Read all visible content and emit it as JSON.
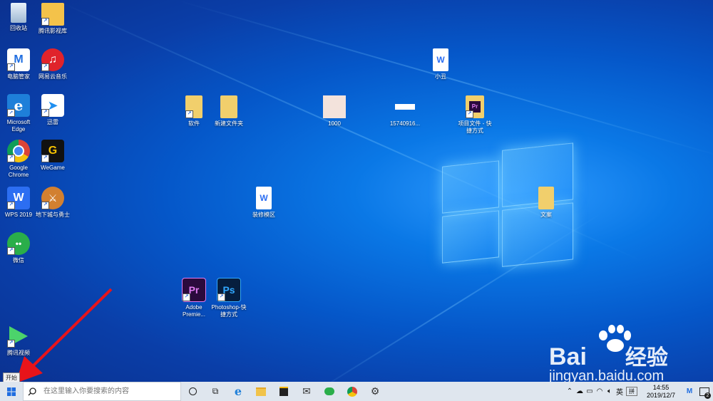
{
  "desktop_icons": {
    "recycle_bin": "回收站",
    "tencent_video_library": "腾讯影视库",
    "pc_manager": "电脑管家",
    "netease_music": "网易云音乐",
    "edge": "Microsoft Edge",
    "xunlei": "迅雷",
    "chrome": "Google Chrome",
    "wegame": "WeGame",
    "wps": "WPS 2019",
    "dnf": "地下城与勇士",
    "wechat": "微信",
    "tencent_video": "腾讯视频",
    "software": "软件",
    "new_folder": "新建文件夹",
    "photo_1000": "1000",
    "file_1574": "15740916...",
    "xiaochou": "小丑",
    "project_shortcut": "项目文件 - 快捷方式",
    "decoration_zone": "装修模区",
    "wenan": "文案",
    "premiere": "Adobe Premie...",
    "photoshop": "Photoshop-快捷方式"
  },
  "taskbar": {
    "start_tooltip": "开始",
    "search_placeholder": "在这里输入你要搜索的内容",
    "ime_lang": "英",
    "ime_mode": "拼",
    "time": "14:55",
    "date": "2019/12/7",
    "notification_count": "2"
  },
  "watermark": {
    "brand": "Bai",
    "brand_suffix": "经验",
    "url": "jingyan.baidu.com"
  },
  "colors": {
    "wallpaper": "#0a6ee0",
    "taskbar": "#dfe6ee",
    "arrow": "#e8141a"
  }
}
